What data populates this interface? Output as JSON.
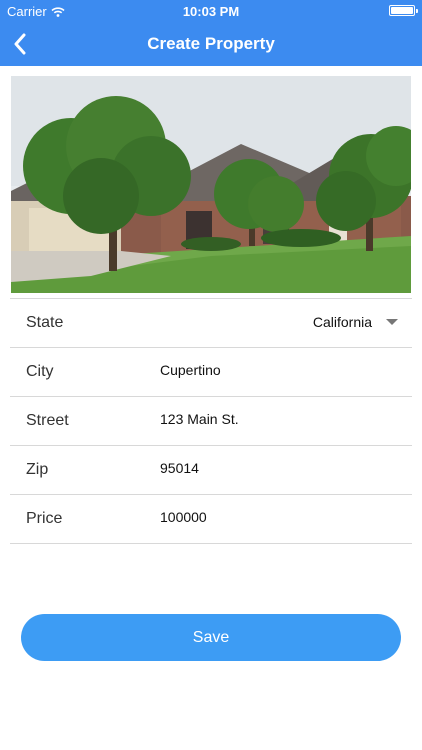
{
  "status_bar": {
    "carrier": "Carrier",
    "time": "10:03 PM",
    "battery_level": 1.0
  },
  "nav": {
    "title": "Create Property",
    "back_icon": "chevron-left-icon"
  },
  "photo": {
    "subject": "house-photo"
  },
  "form": {
    "state": {
      "label": "State",
      "value": "California"
    },
    "city": {
      "label": "City",
      "value": "Cupertino"
    },
    "street": {
      "label": "Street",
      "value": "123 Main St."
    },
    "zip": {
      "label": "Zip",
      "value": "95014"
    },
    "price": {
      "label": "Price",
      "value": "100000"
    }
  },
  "actions": {
    "save_label": "Save"
  },
  "colors": {
    "header": "#3c8bf0",
    "button": "#3d9cf4",
    "divider": "#d8d8d8"
  }
}
